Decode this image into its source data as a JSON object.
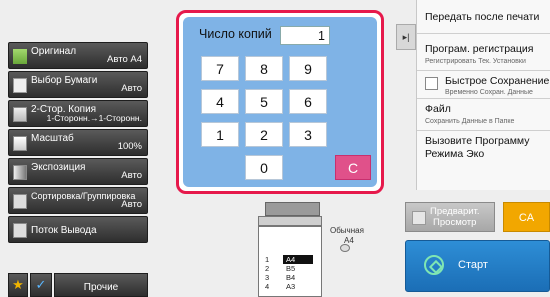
{
  "left_buttons": [
    {
      "title": "Оригинал",
      "value": "Авто   A4",
      "icon": "original-icon"
    },
    {
      "title": "Выбор Бумаги",
      "value": "Авто",
      "icon": "paper-icon"
    },
    {
      "title": "2-Стор. Копия",
      "value": "1-Сторонн.→1-Сторонн.",
      "icon": "duplex-icon"
    },
    {
      "title": "Масштаб",
      "value": "100%",
      "icon": "scale-icon"
    },
    {
      "title": "Экспозиция",
      "value": "Авто",
      "icon": "exposure-icon"
    },
    {
      "title": "Сортировка/Группировка",
      "value": "Авто",
      "icon": "sort-icon"
    },
    {
      "title": "Поток Вывода",
      "value": "",
      "icon": "output-icon"
    }
  ],
  "bottom_left": {
    "other_label": "Прочие",
    "star": "★",
    "check": "✓"
  },
  "keypad": {
    "copies_label": "Число копий",
    "copies_value": "1",
    "keys": [
      "7",
      "8",
      "9",
      "4",
      "5",
      "6",
      "1",
      "2",
      "3",
      "0"
    ],
    "clear_label": "C"
  },
  "device": {
    "normal_label": "Обычная",
    "normal_size": "A4",
    "trays": [
      {
        "num": "1",
        "size": "A4"
      },
      {
        "num": "2",
        "size": "B5"
      },
      {
        "num": "3",
        "size": "B4"
      },
      {
        "num": "4",
        "size": "A3"
      }
    ]
  },
  "right_panel": {
    "expand_glyph": "▸|",
    "transmit_after_print": "Передать после печати",
    "program_register": "Програм. регистрация",
    "program_register_sub": "Регистрировать Тек. Установки",
    "quick_save": "Быстрое Сохранение",
    "quick_save_sub": "Временно Сохран. Данные",
    "file": "Файл",
    "file_sub": "Сохранить Данные в Папке",
    "eco_call_1": "Вызовите Программу",
    "eco_call_2": "Режима Эко"
  },
  "actions": {
    "preview_line1": "Предварит.",
    "preview_line2": "Просмотр",
    "ca_label": "CA",
    "start_label": "Старт"
  },
  "colors": {
    "keypad_bg": "#7fb3e6",
    "highlight_border": "#e6194b",
    "start_blue": "#1b6eb6",
    "ca_orange": "#f2a700",
    "clear_pink": "#e0518a"
  }
}
